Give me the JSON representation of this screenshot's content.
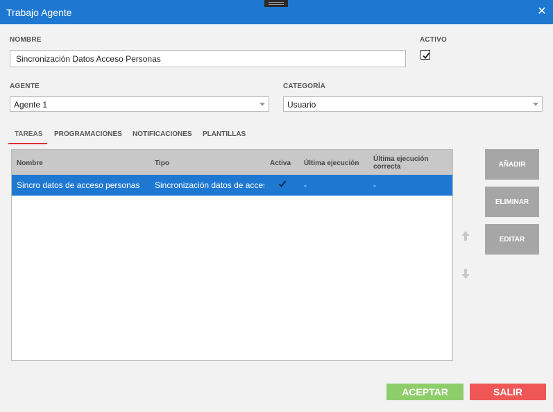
{
  "window": {
    "title": "Trabajo Agente",
    "close_glyph": "✕"
  },
  "form": {
    "nombre_label": "NOMBRE",
    "nombre_value": "Sincronización Datos Acceso Personas",
    "activo_label": "ACTIVO",
    "activo_checked": true,
    "agente_label": "AGENTE",
    "agente_value": "Agente 1",
    "categoria_label": "CATEGORÍA",
    "categoria_value": "Usuario"
  },
  "tabs": [
    {
      "label": "TAREAS",
      "active": true
    },
    {
      "label": "PROGRAMACIONES",
      "active": false
    },
    {
      "label": "NOTIFICACIONES",
      "active": false
    },
    {
      "label": "PLANTILLAS",
      "active": false
    }
  ],
  "grid": {
    "columns": [
      "Nombre",
      "Tipo",
      "Activa",
      "Última ejecución",
      "Última ejecución correcta"
    ],
    "column_last_line1": "Última ejecución",
    "column_last_line2": "correcta",
    "rows": [
      {
        "nombre": "Sincro datos de acceso personas",
        "tipo": "Sincronización datos de acces",
        "activa": true,
        "ultima": "-",
        "ultima_correcta": "-",
        "selected": true
      }
    ]
  },
  "side_buttons": {
    "add": "AÑADIR",
    "delete": "ELIMINAR",
    "edit": "EDITAR"
  },
  "footer": {
    "accept": "ACEPTAR",
    "exit": "SALIR"
  },
  "colors": {
    "titlebar": "#1e78d2",
    "selected_row": "#1e78d2",
    "accept": "#8ece6a",
    "exit": "#ef5757",
    "side_buttons": "#a6a6a6"
  }
}
